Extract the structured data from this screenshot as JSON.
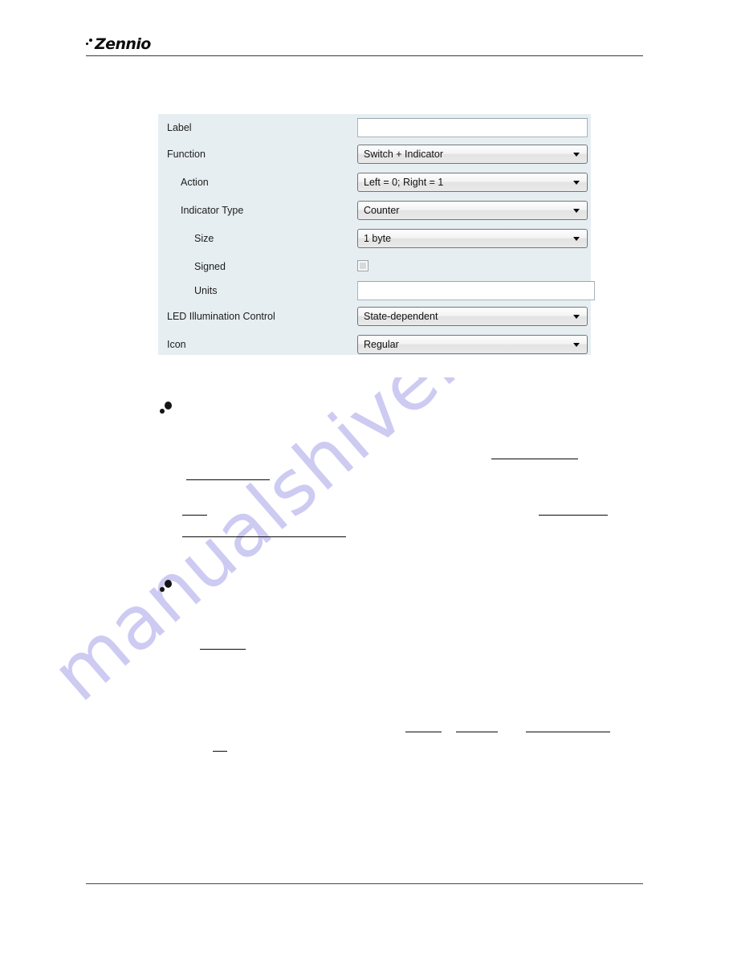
{
  "header": {
    "logo_text": "Zennio"
  },
  "panel": {
    "rows": [
      {
        "label": "Label",
        "indent": 0,
        "control": "textinput",
        "value": ""
      },
      {
        "label": "Function",
        "indent": 0,
        "control": "combo",
        "value": "Switch + Indicator"
      },
      {
        "label": "Action",
        "indent": 1,
        "control": "combo",
        "value": "Left = 0; Right = 1"
      },
      {
        "label": "Indicator Type",
        "indent": 1,
        "control": "combo",
        "value": "Counter"
      },
      {
        "label": "Size",
        "indent": 2,
        "control": "combo",
        "value": "1 byte"
      },
      {
        "label": "Signed",
        "indent": 2,
        "control": "checkbox",
        "value": "unchecked"
      },
      {
        "label": "Units",
        "indent": 2,
        "control": "textinput",
        "value": ""
      },
      {
        "label": "LED Illumination Control",
        "indent": 0,
        "control": "combo",
        "value": "State-dependent"
      },
      {
        "label": "Icon",
        "indent": 0,
        "control": "combo",
        "value": "Regular"
      }
    ]
  },
  "watermark": {
    "text": "manualshive.com"
  },
  "colors": {
    "panel_background": "#e7eef1",
    "watermark": "#cdcbf2",
    "rule": "#3a3a3a",
    "text": "#1d1d1d"
  }
}
